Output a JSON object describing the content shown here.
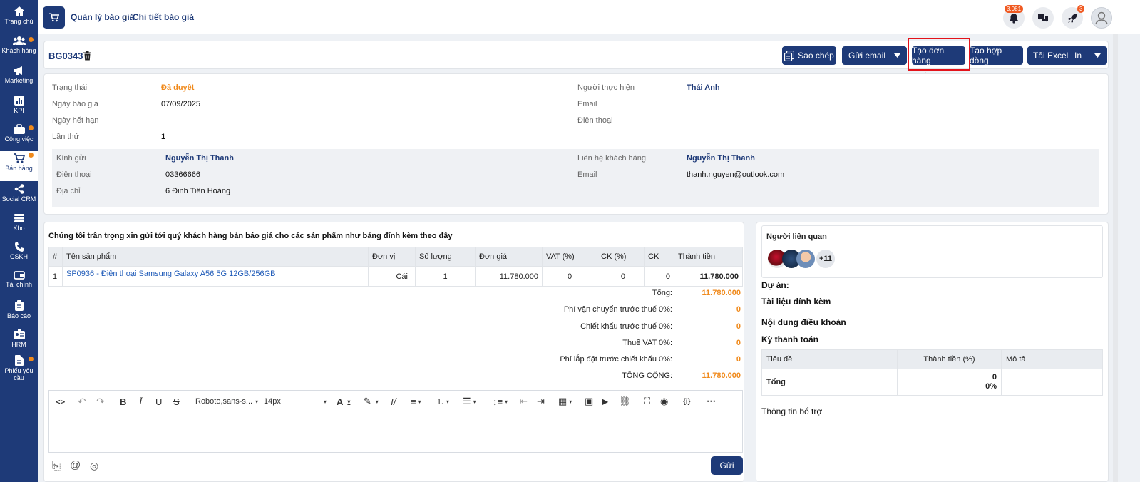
{
  "sidebar": {
    "items": [
      {
        "label": "Trang chủ",
        "icon": "home-icon"
      },
      {
        "label": "Khách hàng",
        "icon": "users-icon",
        "dot": true
      },
      {
        "label": "Marketing",
        "icon": "megaphone-icon"
      },
      {
        "label": "KPI",
        "icon": "chart-icon"
      },
      {
        "label": "Công việc",
        "icon": "briefcase-icon",
        "dot": true
      },
      {
        "label": "Bán hàng",
        "icon": "cart-icon",
        "dot": true,
        "active": true
      },
      {
        "label": "Social CRM",
        "icon": "share-icon"
      },
      {
        "label": "Kho",
        "icon": "warehouse-icon"
      },
      {
        "label": "CSKH",
        "icon": "phone-icon"
      },
      {
        "label": "Tài chính",
        "icon": "wallet-icon"
      },
      {
        "label": "Báo cáo",
        "icon": "clipboard-icon"
      },
      {
        "label": "HRM",
        "icon": "id-card-icon"
      },
      {
        "label": "Phiếu yêu cầu",
        "icon": "document-icon",
        "dot": true
      }
    ]
  },
  "breadcrumb": {
    "parent": "Quản lý báo giá",
    "current": "Chi tiết báo giá"
  },
  "notifications": {
    "count": "3,081",
    "rocket_count": "3"
  },
  "quote": {
    "code": "BG0343"
  },
  "actions": {
    "copy": "Sao chép",
    "email": "Gửi email",
    "create_order": "Tạo đơn hàng",
    "create_contract": "Tạo hợp đồng",
    "download_excel": "Tải Excel",
    "print": "In"
  },
  "info": {
    "status_label": "Trạng thái",
    "status": "Đã duyệt",
    "quote_date_label": "Ngày báo giá",
    "quote_date": "07/09/2025",
    "expire_label": "Ngày hết hạn",
    "times_label": "Lần thứ",
    "times": "1",
    "executor_label": "Người thực hiện",
    "executor": "Thái Anh",
    "email_label": "Email",
    "phone_label": "Điện thoại",
    "to_label": "Kính gửi",
    "to": "Nguyễn Thị Thanh",
    "to_phone_label": "Điện thoại",
    "to_phone": "03366666",
    "address_label": "Địa chỉ",
    "address": "6 Đinh Tiên Hoàng",
    "contact_label": "Liên hệ khách hàng",
    "contact": "Nguyễn Thị Thanh",
    "contact_email_label": "Email",
    "contact_email": "thanh.nguyen@outlook.com"
  },
  "intro": "Chúng tôi trân trọng xin gửi tới quý khách hàng bản báo giá cho các sản phẩm như bảng đính kèm theo đây",
  "table": {
    "headers": [
      "#",
      "Tên sản phẩm",
      "Đơn vị",
      "Số lượng",
      "Đơn giá",
      "VAT (%)",
      "CK (%)",
      "CK",
      "Thành tiền"
    ],
    "rows": [
      [
        "1",
        "SP0936 - Điện thoại Samsung Galaxy A56 5G 12GB/256GB",
        "Cái",
        "1",
        "11.780.000",
        "0",
        "0",
        "0",
        "11.780.000"
      ]
    ]
  },
  "summary": [
    {
      "label": "Tổng:",
      "value": "11.780.000"
    },
    {
      "label": "Phí vận chuyển trước thuế 0%:",
      "value": "0"
    },
    {
      "label": "Chiết khấu trước thuế 0%:",
      "value": "0"
    },
    {
      "label": "Thuế VAT 0%:",
      "value": "0"
    },
    {
      "label": "Phí lắp đặt trước chiết khấu 0%:",
      "value": "0"
    },
    {
      "label": "TỔNG CỘNG:",
      "value": "11.780.000"
    }
  ],
  "editor": {
    "font": "Roboto,sans-s...",
    "size": "14px"
  },
  "send": "Gửi",
  "right": {
    "related_title": "Người liên quan",
    "related_more": "+11",
    "project": "Dự án:",
    "attachments": "Tài liệu đính kèm",
    "terms": "Nội dung điều khoản",
    "payment": "Kỳ thanh toán",
    "pay_headers": [
      "Tiêu đề",
      "Thành tiền (%)",
      "Mô tả"
    ],
    "pay_total_label": "Tổng",
    "pay_total_value": "0",
    "pay_total_pct": "0%",
    "extra": "Thông tin bổ trợ"
  },
  "colors": {
    "primary": "#1e3a78",
    "accent": "#f08a1c",
    "highlight": "#e3131a"
  }
}
